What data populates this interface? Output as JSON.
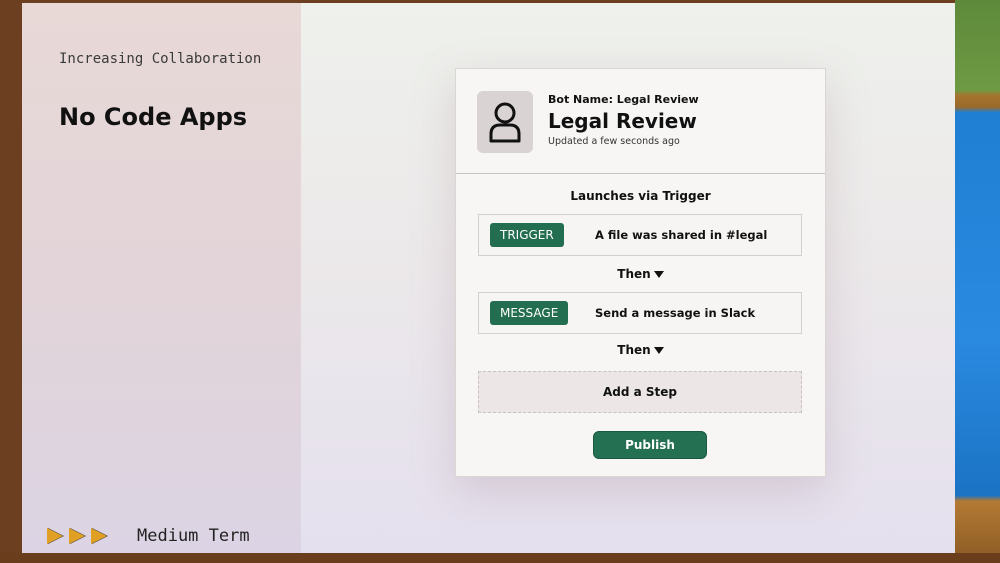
{
  "slide": {
    "kicker": "Increasing Collaboration",
    "headline": "No Code Apps",
    "footer_term": "Medium Term",
    "accent_color": "#e0a024"
  },
  "bot": {
    "name_label": "Bot Name: Legal Review",
    "title": "Legal Review",
    "updated": "Updated a few seconds ago",
    "avatar_icon": "user-icon",
    "launch_text": "Launches via Trigger",
    "steps": [
      {
        "tag": "TRIGGER",
        "description": "A file was shared in #legal"
      },
      {
        "tag": "MESSAGE",
        "description": "Send a message in Slack"
      }
    ],
    "then_label": "Then",
    "add_step_label": "Add a Step",
    "publish_label": "Publish",
    "brand_color": "#236e50"
  }
}
